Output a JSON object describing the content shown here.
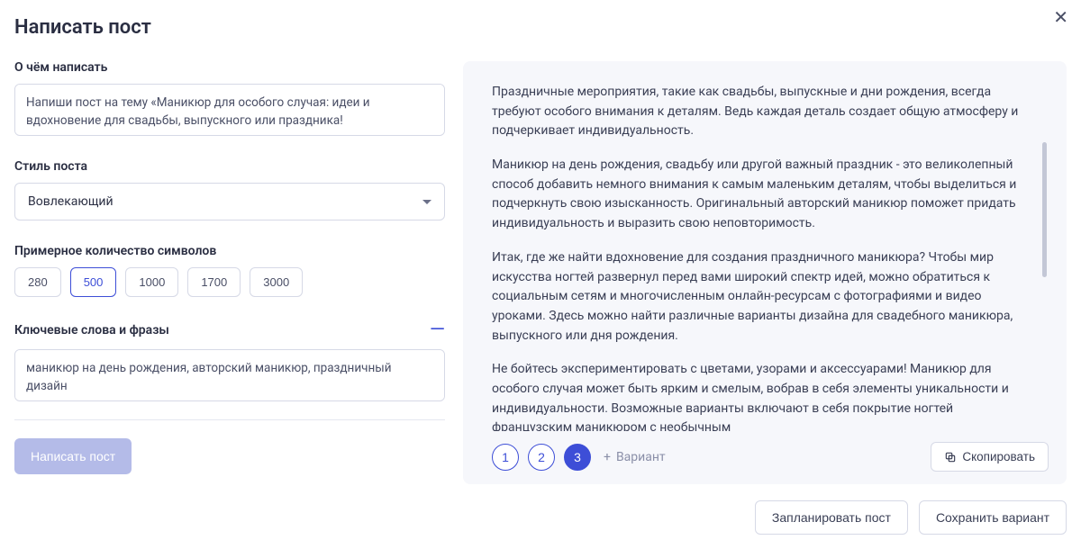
{
  "title": "Написать пост",
  "close_icon": "close-icon",
  "sections": {
    "topic": {
      "label": "О чём написать",
      "value": "Напиши пост на тему «Маникюр для особого случая: идеи и вдохновение для свадьбы, выпускного или праздника!"
    },
    "style": {
      "label": "Стиль поста",
      "selected": "Вовлекающий"
    },
    "length": {
      "label": "Примерное количество символов",
      "options": [
        "280",
        "500",
        "1000",
        "1700",
        "3000"
      ],
      "selected": "500"
    },
    "keywords": {
      "label": "Ключевые слова и фразы",
      "value": "маникюр на день рождения, авторский маникюр, праздничный дизайн"
    }
  },
  "generate_button": "Написать пост",
  "preview": {
    "paragraphs": [
      "Праздничные мероприятия, такие как свадьбы, выпускные и дни рождения, всегда требуют особого внимания к деталям. Ведь каждая деталь создает общую атмосферу и подчеркивает индивидуальность.",
      "Маникюр на день рождения, свадьбу или другой важный праздник - это великолепный способ добавить немного внимания к самым маленьким деталям, чтобы выделиться и подчеркнуть свою изысканность. Оригинальный авторский маникюр поможет придать индивидуальность и выразить свою неповторимость.",
      "Итак, где же найти вдохновение для создания праздничного маникюра? Чтобы мир искусства ногтей развернул перед вами широкий спектр идей, можно обратиться к социальным сетям и многочисленным онлайн-ресурсам с фотографиями и видео уроками. Здесь можно найти различные варианты дизайна для свадебного маникюра, выпускного или дня рождения.",
      "Не бойтесь экспериментировать с цветами, узорами и аксессуарами! Маникюр для особого случая может быть ярким и смелым, вобрав в себя элементы уникальности и индивидуальности. Возможные варианты включают в себя покрытие ногтей французским маникюром с необычным"
    ],
    "variants": {
      "list": [
        "1",
        "2",
        "3"
      ],
      "active": "3",
      "add_label": "Вариант"
    },
    "copy_label": "Скопировать"
  },
  "footer": {
    "schedule": "Запланировать пост",
    "save": "Сохранить вариант"
  }
}
